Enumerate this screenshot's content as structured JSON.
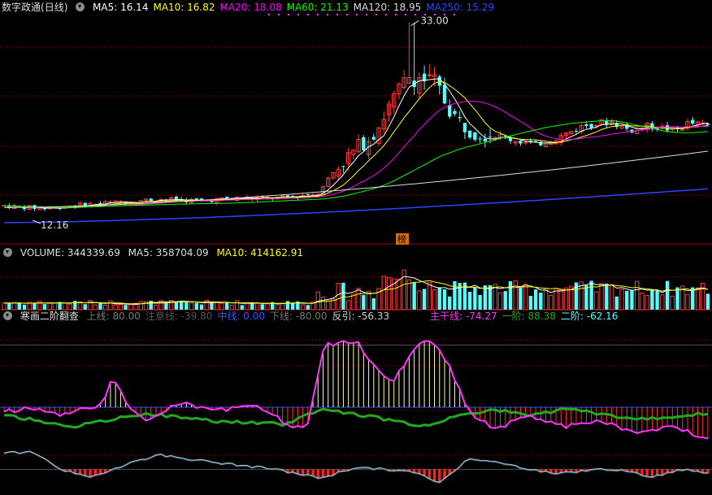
{
  "colors": {
    "up": "#ff3c3c",
    "down": "#54ffff",
    "ma5": "#ffffff",
    "ma10": "#ffff00",
    "ma20": "#ff00ff",
    "ma60": "#00ff00",
    "ma120": "#dddddd",
    "ma250": "#2a45ff",
    "grid": "#8b0000",
    "main_line": "#ff33ff",
    "level1": "#22aa22",
    "mid_line": "#3355ff",
    "label_gray": "#777777"
  },
  "price_panel": {
    "stock_name": "数字政通",
    "period": "(日线)",
    "ma_labels": [
      {
        "text": "MA5: 16.14",
        "color": "#ffffff"
      },
      {
        "text": "MA10: 16.82",
        "color": "#ffff00"
      },
      {
        "text": "MA20: 18.08",
        "color": "#ff00ff"
      },
      {
        "text": "MA60: 21.13",
        "color": "#00ff00"
      },
      {
        "text": "MA120: 18.95",
        "color": "#dddddd"
      },
      {
        "text": "MA250: 15.29",
        "color": "#2a45ff"
      }
    ],
    "high_label": "33.00",
    "low_label": "12.16",
    "badge": "榜"
  },
  "volume_panel": {
    "title": "VOLUME: 344339.69",
    "ma5": "MA5: 358704.09",
    "ma10": "MA10: 414162.91"
  },
  "indicator_panel": {
    "name": "寒画二阶翻查",
    "items": [
      {
        "text": "上线: 80.00",
        "color": "#777777"
      },
      {
        "text": "注意线: -39.80",
        "color": "#555555"
      },
      {
        "text": "中线: 0.00",
        "color": "#3355ff"
      },
      {
        "text": "下线: -80.00",
        "color": "#777777"
      },
      {
        "text": "反引: -56.33",
        "color": "#cccccc"
      },
      {
        "text": "主干线: -74.27",
        "color": "#ff33ff"
      },
      {
        "text": "一阶: 88.38",
        "color": "#22aa22"
      },
      {
        "text": "二阶: -62.16",
        "color": "#54ffff"
      }
    ]
  },
  "chart_data": [
    {
      "type": "candlestick",
      "title": "数字政通 (日线)",
      "x_count": 140,
      "ylim": [
        11,
        34
      ],
      "price_keypoints": [
        [
          0,
          13.5
        ],
        [
          10,
          13.2
        ],
        [
          20,
          13.6
        ],
        [
          30,
          13.9
        ],
        [
          40,
          14.2
        ],
        [
          50,
          14.0
        ],
        [
          60,
          14.3
        ],
        [
          70,
          14.3
        ],
        [
          80,
          14.8
        ],
        [
          85,
          17.5
        ],
        [
          90,
          19.5
        ],
        [
          95,
          21.5
        ],
        [
          97,
          23.0
        ],
        [
          100,
          25.0
        ],
        [
          104,
          27.5
        ],
        [
          110,
          26.5
        ],
        [
          116,
          22.5
        ],
        [
          120,
          21.5
        ],
        [
          126,
          21.0
        ],
        [
          130,
          20.5
        ],
        [
          136,
          20.0
        ],
        [
          142,
          20.8
        ],
        [
          148,
          22.0
        ],
        [
          155,
          22.5
        ],
        [
          160,
          21.5
        ],
        [
          165,
          22.0
        ],
        [
          172,
          21.5
        ],
        [
          175,
          22.3
        ],
        [
          180,
          22.0
        ]
      ],
      "annotations": [
        {
          "text": "33.00",
          "kind": "high"
        },
        {
          "text": "12.16",
          "kind": "low"
        }
      ],
      "series": [
        {
          "name": "MA5",
          "last": 16.14
        },
        {
          "name": "MA10",
          "last": 16.82
        },
        {
          "name": "MA20",
          "last": 18.08
        },
        {
          "name": "MA60",
          "last": 21.13
        },
        {
          "name": "MA120",
          "last": 18.95
        },
        {
          "name": "MA250",
          "last": 15.29
        }
      ]
    },
    {
      "type": "bar",
      "title": "VOLUME",
      "ylim": [
        0,
        700000
      ],
      "series": [
        {
          "name": "VOLUME",
          "last": 344339.69
        },
        {
          "name": "MA5",
          "last": 358704.09
        },
        {
          "name": "MA10",
          "last": 414162.91
        }
      ]
    },
    {
      "type": "line",
      "title": "寒画二阶翻查",
      "ylim": [
        -110,
        110
      ],
      "reference_lines": [
        80,
        0,
        -80
      ],
      "series": [
        {
          "name": "主干线",
          "last": -74.27
        },
        {
          "name": "一阶",
          "last": 88.38
        },
        {
          "name": "二阶",
          "last": -62.16
        },
        {
          "name": "反引",
          "last": -56.33
        }
      ]
    }
  ]
}
